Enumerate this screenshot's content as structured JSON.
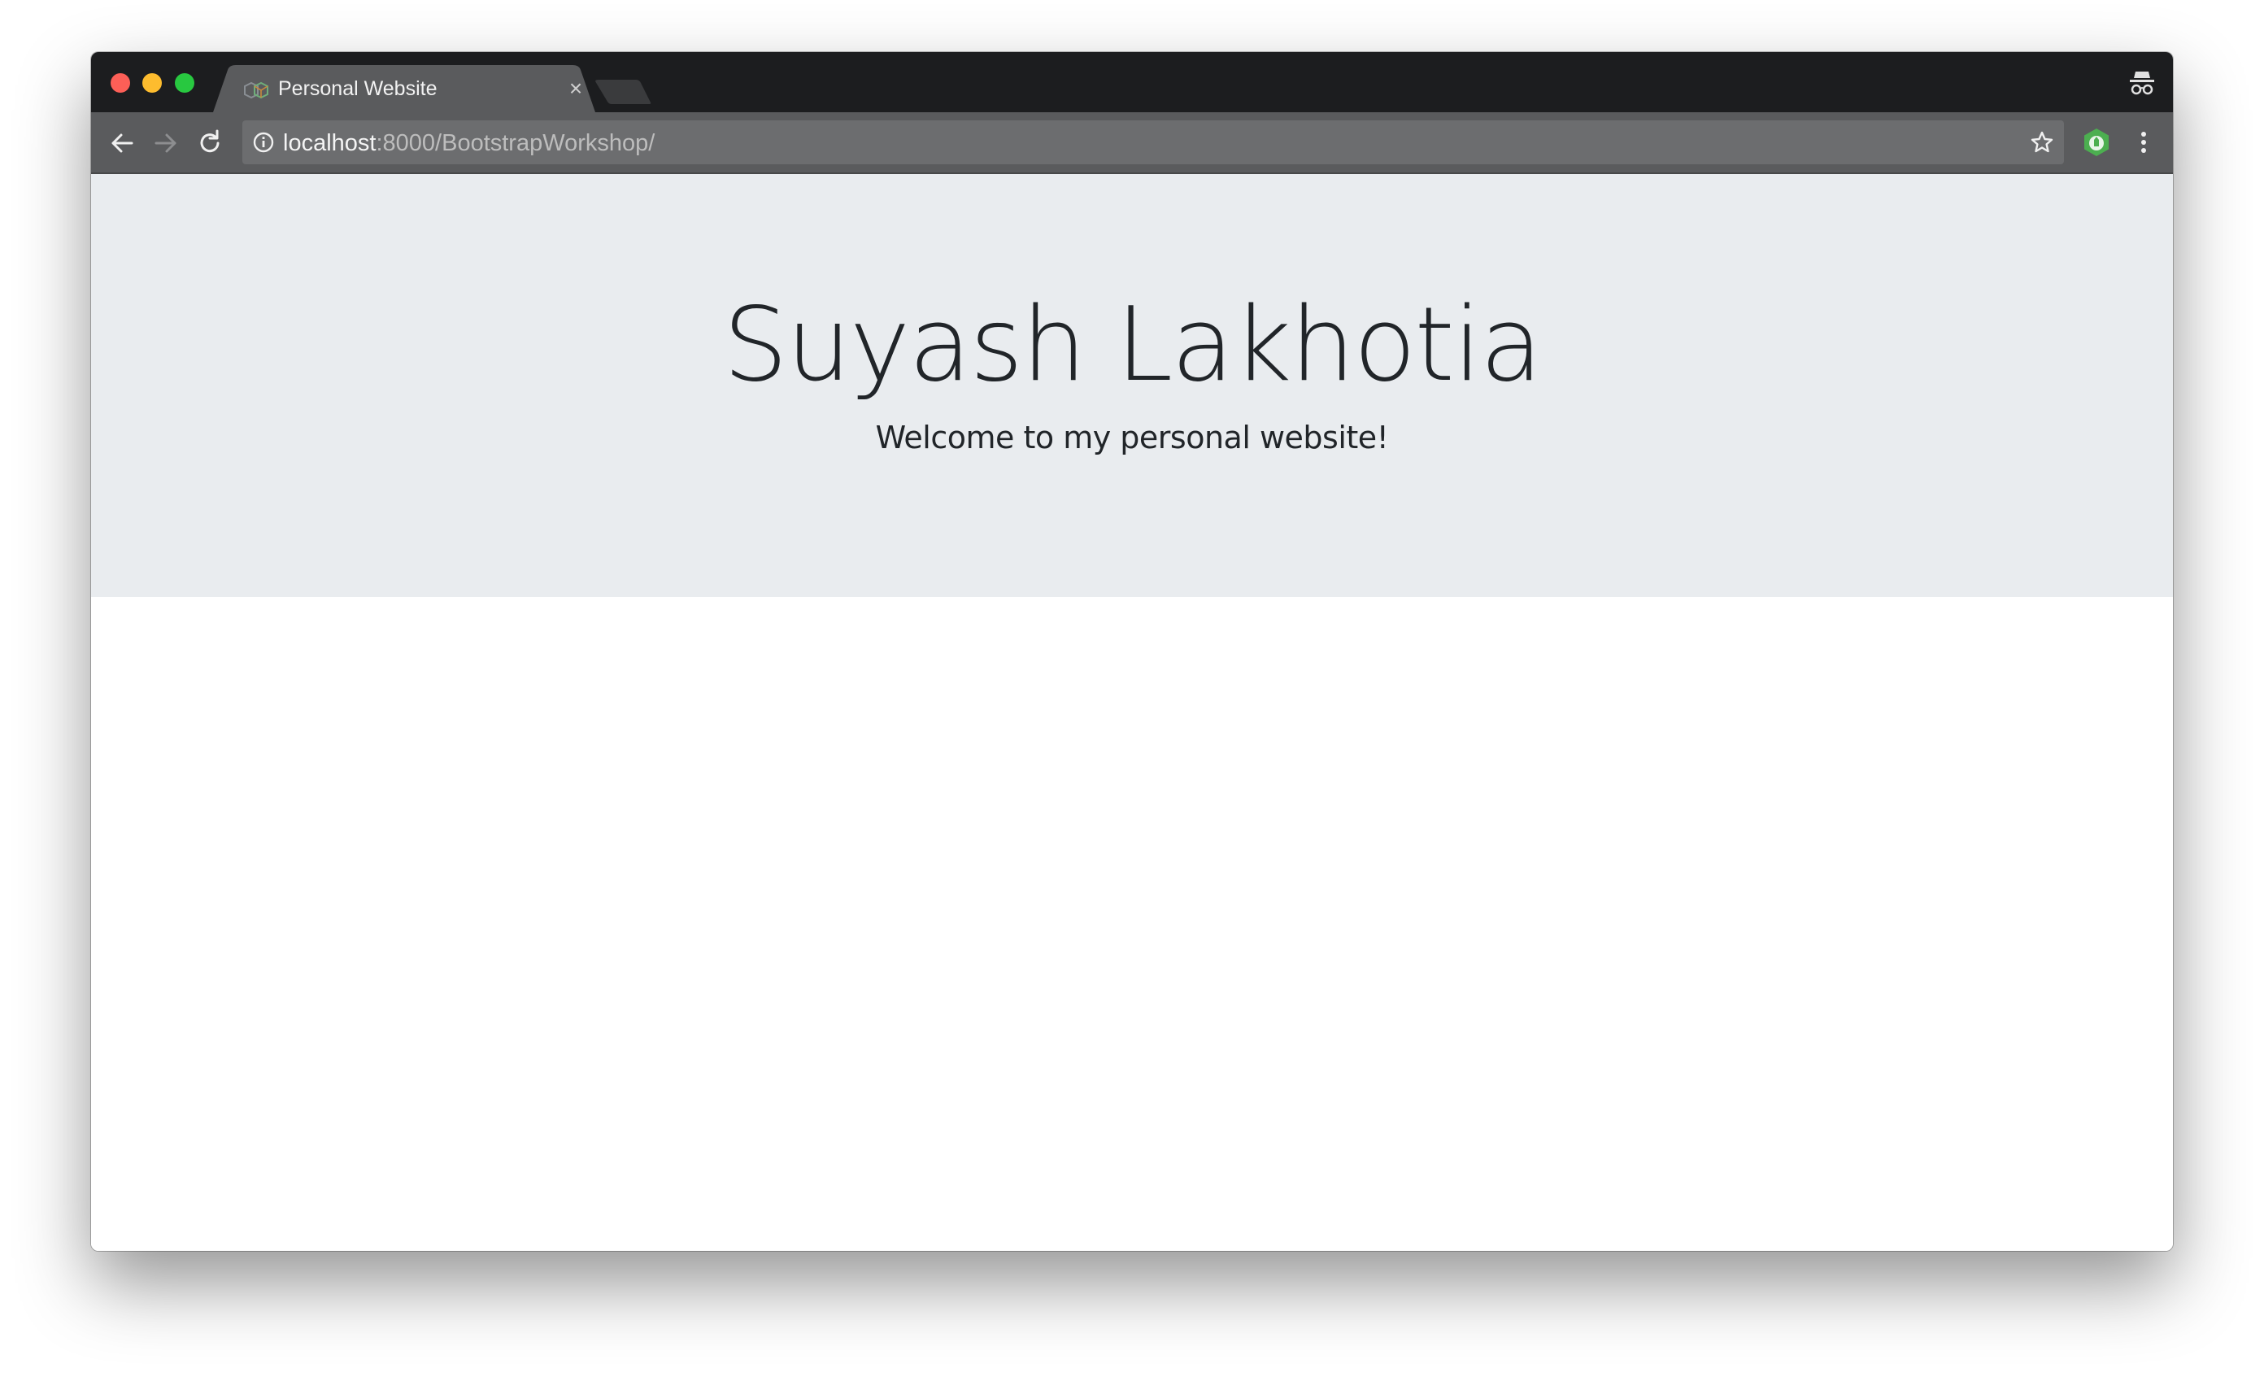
{
  "browser": {
    "tab": {
      "title": "Personal Website",
      "close_glyph": "×"
    },
    "address_bar": {
      "host": "localhost",
      "rest": ":8000/BootstrapWorkshop/"
    },
    "icons": {
      "back": "arrow-left-icon",
      "forward": "arrow-right-icon",
      "reload": "reload-icon",
      "site_info": "info-icon",
      "bookmark": "star-icon",
      "extension": "green-extension-icon",
      "menu": "vertical-dots-menu-icon",
      "incognito": "incognito-icon"
    },
    "colors": {
      "titlebar": "#1c1d1f",
      "toolbar": "#5a5b5d",
      "omnibox": "#6c6d6f"
    }
  },
  "page": {
    "jumbotron": {
      "title": "Suyash Lakhotia",
      "lead": "Welcome to my personal website!"
    },
    "colors": {
      "jumbotron_bg": "#e9ecef",
      "text": "#212529"
    }
  }
}
